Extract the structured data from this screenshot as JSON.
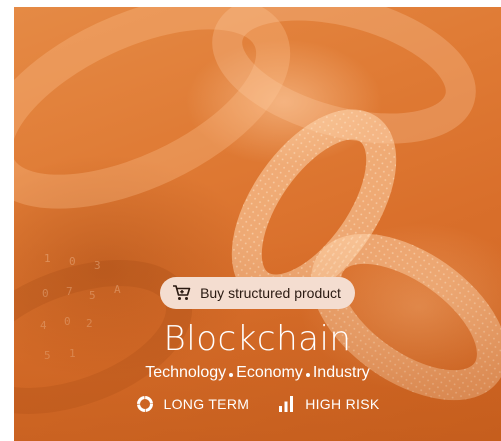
{
  "card": {
    "buy_label": "Buy structured product",
    "title": "Blockchain",
    "tags": [
      "Technology",
      "Economy",
      "Industry"
    ],
    "horizon_label": "LONG TERM",
    "risk_label": "HIGH RISK",
    "accent_color": "#df7a34"
  },
  "icons": {
    "buy": "cart-icon",
    "horizon": "ring-icon",
    "risk": "bars-icon"
  }
}
